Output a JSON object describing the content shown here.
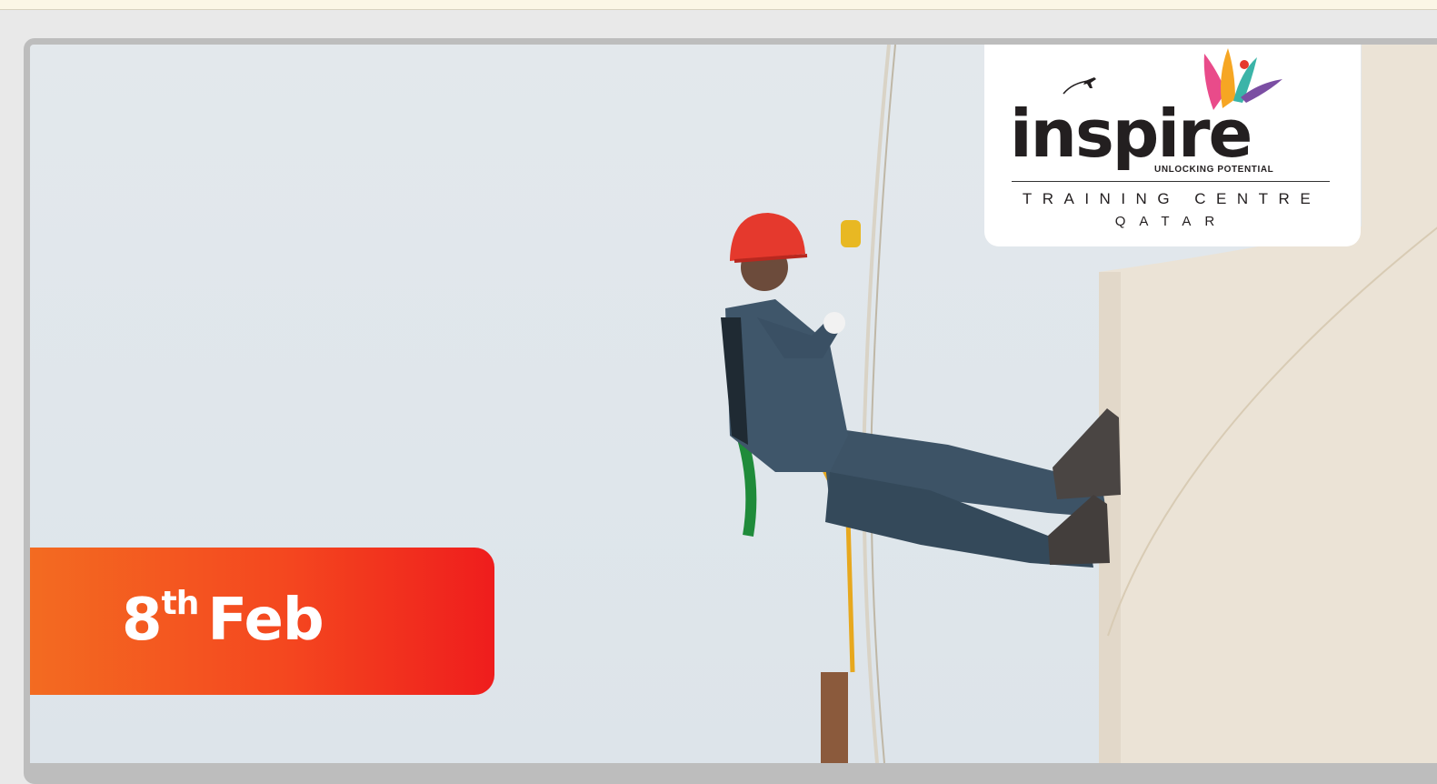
{
  "banner": {
    "logo": {
      "wordmark": "inspire",
      "tagline": "UNLOCKING POTENTIAL",
      "line2": "TRAINING CENTRE",
      "line3": "QATAR"
    },
    "date": {
      "day": "8",
      "suffix": "th",
      "month": "Feb"
    },
    "colors": {
      "badge_start": "#f36b21",
      "badge_end": "#ef1d1d",
      "sky": "#e1e7ec",
      "tank": "#ebe3d6",
      "helmet": "#e5392d",
      "coverall": "#3d5366"
    },
    "icons": [
      "airplane-icon",
      "hummingbird-icon"
    ]
  }
}
